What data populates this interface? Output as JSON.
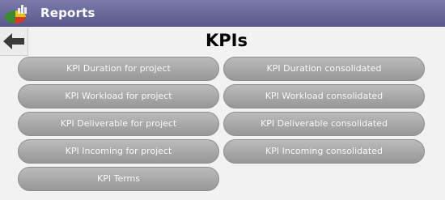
{
  "header": {
    "title": "Reports",
    "icon": "reports-chart-icon"
  },
  "nav": {
    "back_icon": "back-arrow-icon"
  },
  "main": {
    "page_title": "KPIs",
    "buttons": {
      "duration_project": "KPI Duration for project",
      "duration_consolidated": "KPI Duration consolidated",
      "workload_project": "KPI Workload for project",
      "workload_consolidated": "KPI Workload consolidated",
      "deliverable_project": "KPI Deliverable for project",
      "deliverable_consolidated": "KPI Deliverable consolidated",
      "incoming_project": "KPI Incoming for project",
      "incoming_consolidated": "KPI Incoming consolidated",
      "terms": "KPI Terms"
    }
  },
  "colors": {
    "titlebar": "#6a6a9e",
    "button": "#a9a9a9",
    "button_text": "#ffffff",
    "background": "#f2f2f2"
  }
}
